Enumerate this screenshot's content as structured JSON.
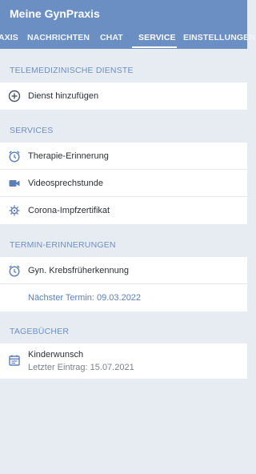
{
  "app": {
    "title": "Meine GynPraxis"
  },
  "tabs": [
    {
      "label": "AXIS"
    },
    {
      "label": "NACHRICHTEN"
    },
    {
      "label": "CHAT"
    },
    {
      "label": "SERVICE"
    },
    {
      "label": "EINSTELLUNGEN"
    }
  ],
  "sections": {
    "telemedicine": {
      "header": "TELEMEDIZINISCHE DIENSTE",
      "items": [
        {
          "label": "Dienst hinzufügen",
          "icon": "add-circle-icon"
        }
      ]
    },
    "services": {
      "header": "SERVICES",
      "items": [
        {
          "label": "Therapie-Erinnerung",
          "icon": "alarm-clock-icon"
        },
        {
          "label": "Videosprechstunde",
          "icon": "video-camera-icon"
        },
        {
          "label": "Corona-Impfzertifikat",
          "icon": "virus-icon"
        }
      ]
    },
    "reminders": {
      "header": "TERMIN-ERINNERUNGEN",
      "items": [
        {
          "label": "Gyn. Krebsfrüherkennung",
          "icon": "alarm-clock-icon"
        }
      ],
      "next_appointment": "Nächster Termin: 09.03.2022"
    },
    "diaries": {
      "header": "TAGEBÜCHER",
      "items": [
        {
          "label": "Kinderwunsch",
          "sub": "Letzter Eintrag: 15.07.2021",
          "icon": "calendar-icon"
        }
      ]
    }
  },
  "colors": {
    "appbar": "#6b8fc3",
    "accent": "#5b7fb7",
    "background": "#e7ecf3"
  }
}
